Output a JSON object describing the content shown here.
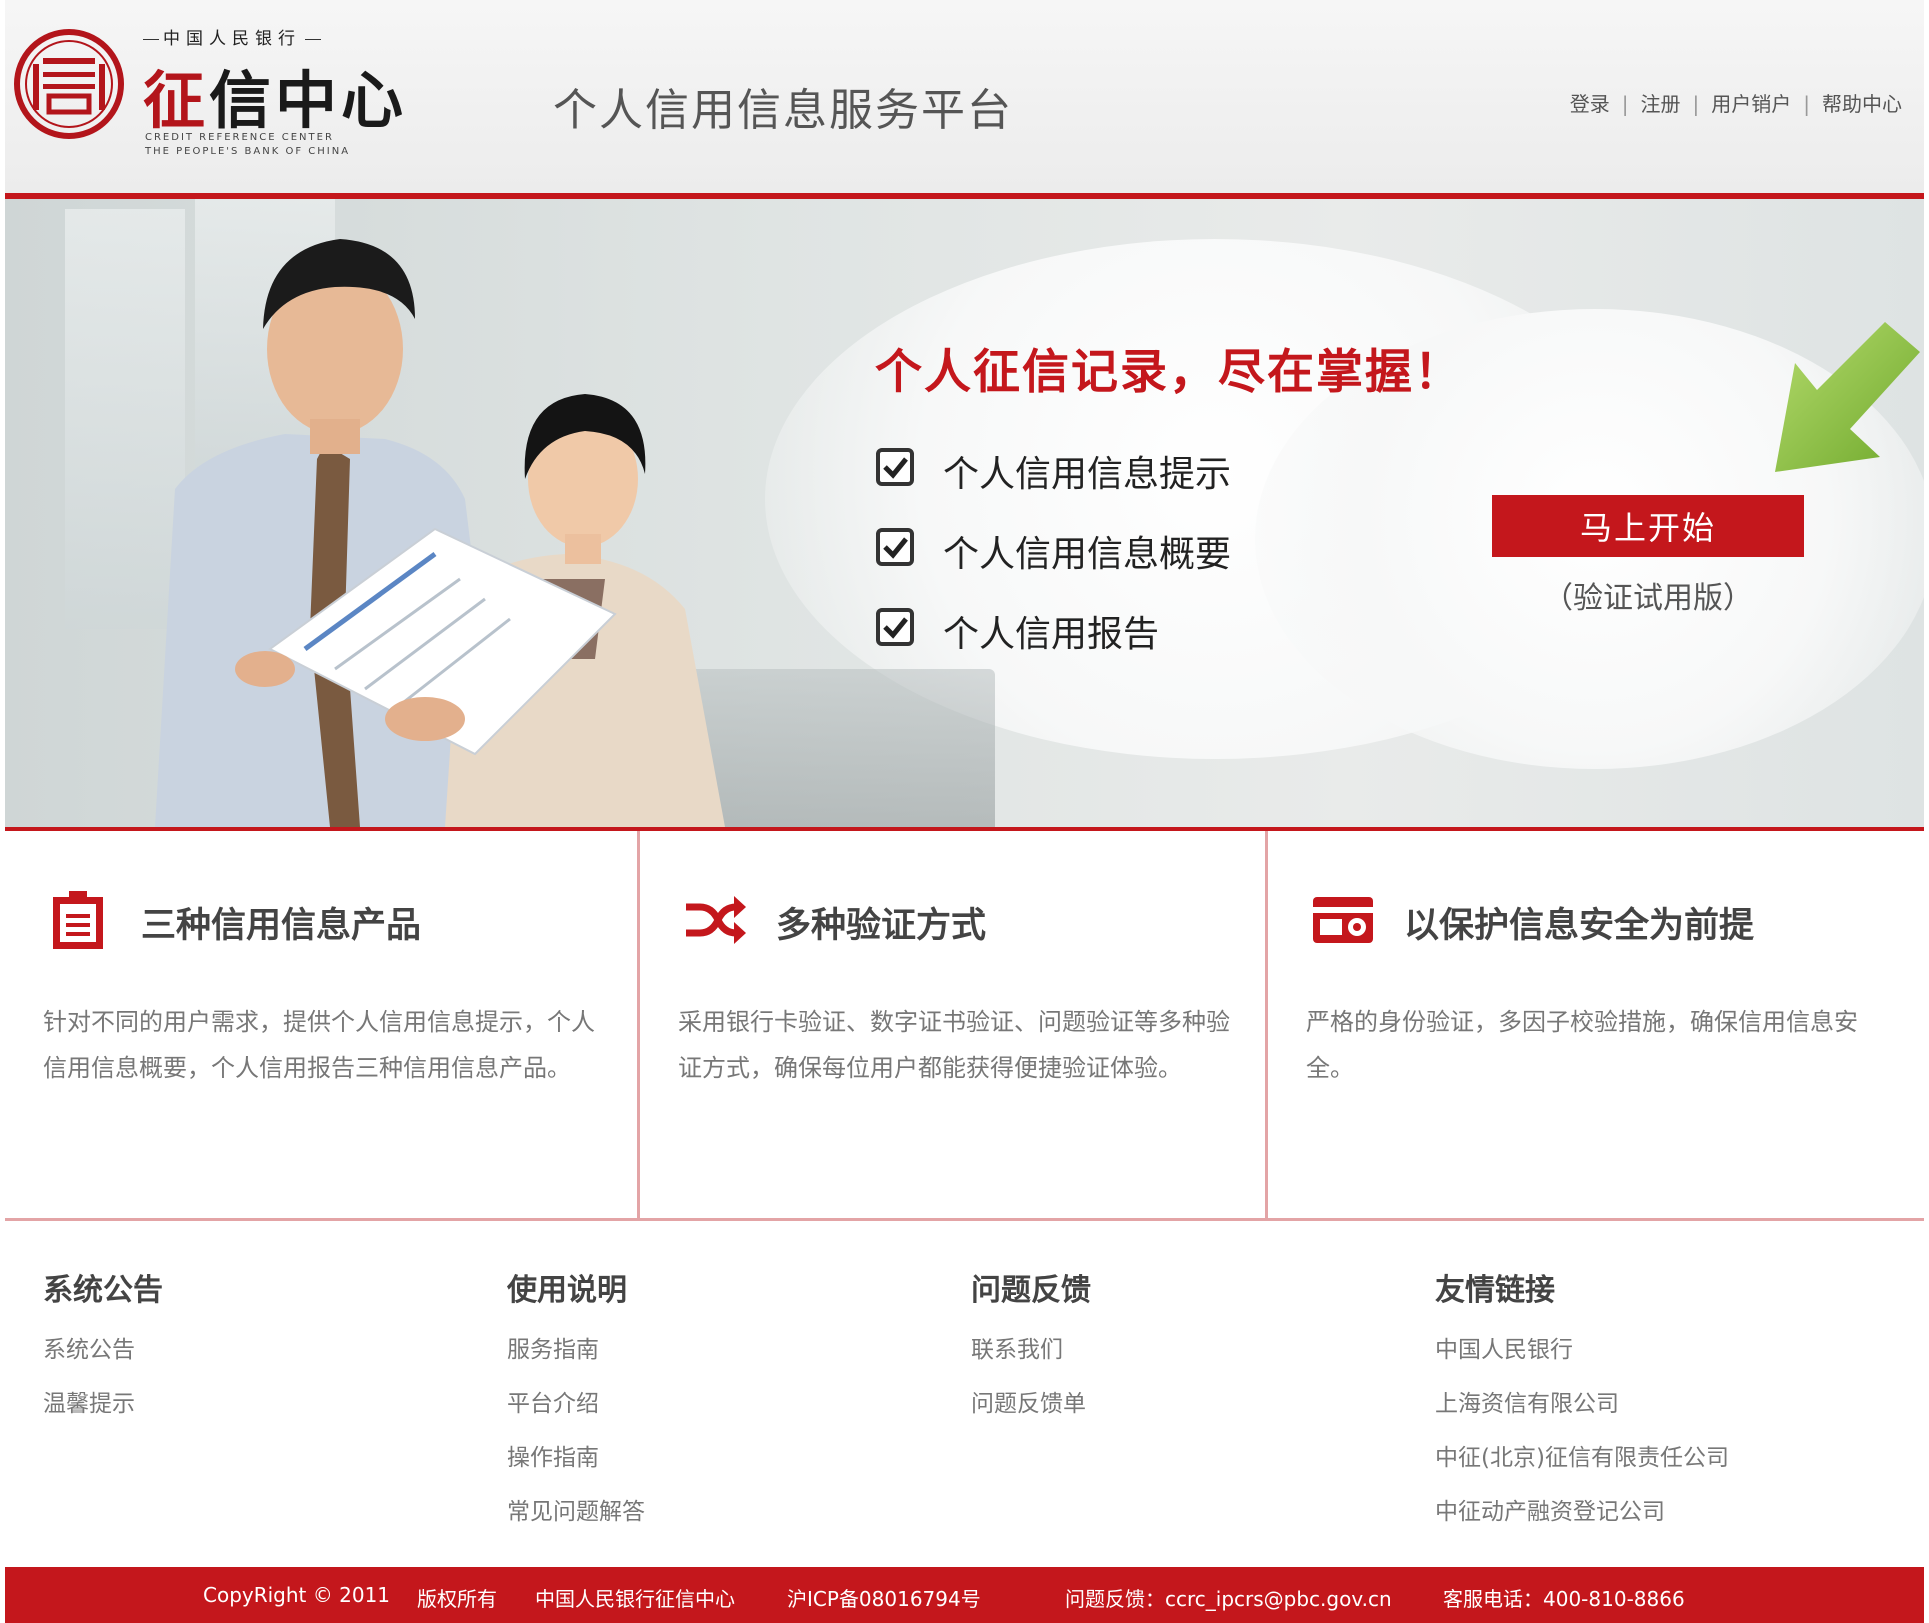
{
  "header": {
    "logo": {
      "seal_glyph": "信",
      "top_text": "中国人民银行",
      "main_first": "征",
      "main_rest": "信中心",
      "en_line1": "CREDIT REFERENCE CENTER",
      "en_line2": "THE PEOPLE'S BANK OF CHINA"
    },
    "site_title": "个人信用信息服务平台",
    "nav": [
      "登录",
      "注册",
      "用户销户",
      "帮助中心"
    ],
    "nav_separator": "|"
  },
  "banner": {
    "slogan": "个人征信记录，尽在掌握！",
    "features": [
      "个人信用信息提示",
      "个人信用信息概要",
      "个人信用报告"
    ],
    "start_button": "马上开始",
    "trial_note": "（验证试用版）"
  },
  "info": [
    {
      "icon": "clipboard-icon",
      "title": "三种信用信息产品",
      "desc": "针对不同的用户需求，提供个人信用信息提示，个人信用信息概要，个人信用报告三种信用信息产品。"
    },
    {
      "icon": "shuffle-icon",
      "title": "多种验证方式",
      "desc": "采用银行卡验证、数字证书验证、问题验证等多种验证方式，确保每位用户都能获得便捷验证体验。"
    },
    {
      "icon": "id-card-icon",
      "title": "以保护信息安全为前提",
      "desc": "严格的身份验证，多因子校验措施，确保信用信息安全。"
    }
  ],
  "links": [
    {
      "heading": "系统公告",
      "items": [
        "系统公告",
        "温馨提示"
      ]
    },
    {
      "heading": "使用说明",
      "items": [
        "服务指南",
        "平台介绍",
        "操作指南",
        "常见问题解答"
      ]
    },
    {
      "heading": "问题反馈",
      "items": [
        "联系我们",
        "问题反馈单"
      ]
    },
    {
      "heading": "友情链接",
      "items": [
        "中国人民银行",
        "上海资信有限公司",
        "中征(北京)征信有限责任公司",
        "中征动产融资登记公司"
      ]
    }
  ],
  "footer": {
    "copyright": "CopyRight © 2011",
    "rights": "版权所有",
    "org": "中国人民银行征信中心",
    "icp": "沪ICP备08016794号",
    "feedback": "问题反馈：ccrc_ipcrs@pbc.gov.cn",
    "hotline": "客服电话：400-810-8866"
  },
  "colors": {
    "brand_red": "#c4171c",
    "divider_pink": "#e3a4a6",
    "arrow_green": "#8cc63f"
  }
}
